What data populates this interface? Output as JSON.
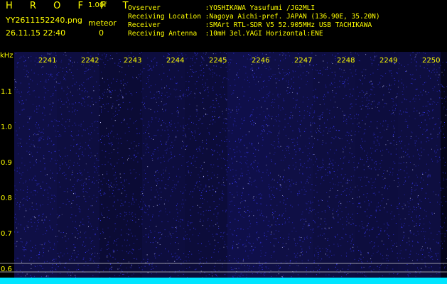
{
  "header": {
    "title": "H R O F F T",
    "version": "1.00f",
    "filename": "YY2611152240.png",
    "meteor_label": "meteor",
    "datetime": "26.11.15 22:40",
    "meteor_count": "0"
  },
  "info": {
    "observer": "Ovserver           :YOSHIKAWA Yasufumi /JG2MLI",
    "location": "Receiving Location :Nagoya Aichi-pref. JAPAN (136.90E, 35.20N)",
    "receiver": "Receiver           :SMArt RTL-SDR V5 52.905MHz USB TACHIKAWA",
    "antenna": "Receiving Antenna  :10mH 3el.YAGI Horizontal:ENE"
  },
  "axis": {
    "unit": "kHz",
    "yticks": [
      "1.1",
      "1.0",
      "0.9",
      "0.8",
      "0.7",
      "0.6"
    ],
    "xticks": [
      "2241",
      "2242",
      "2243",
      "2244",
      "2245",
      "2246",
      "2247",
      "2248",
      "2249",
      "2250"
    ]
  },
  "colors": {
    "background": "#000000",
    "text": "#ffff00",
    "noise_dot": "#3a3aff",
    "bright_dot": "#c8c8ff",
    "baseline": "#00e5ff",
    "ref_line": "#c8c8c8"
  }
}
